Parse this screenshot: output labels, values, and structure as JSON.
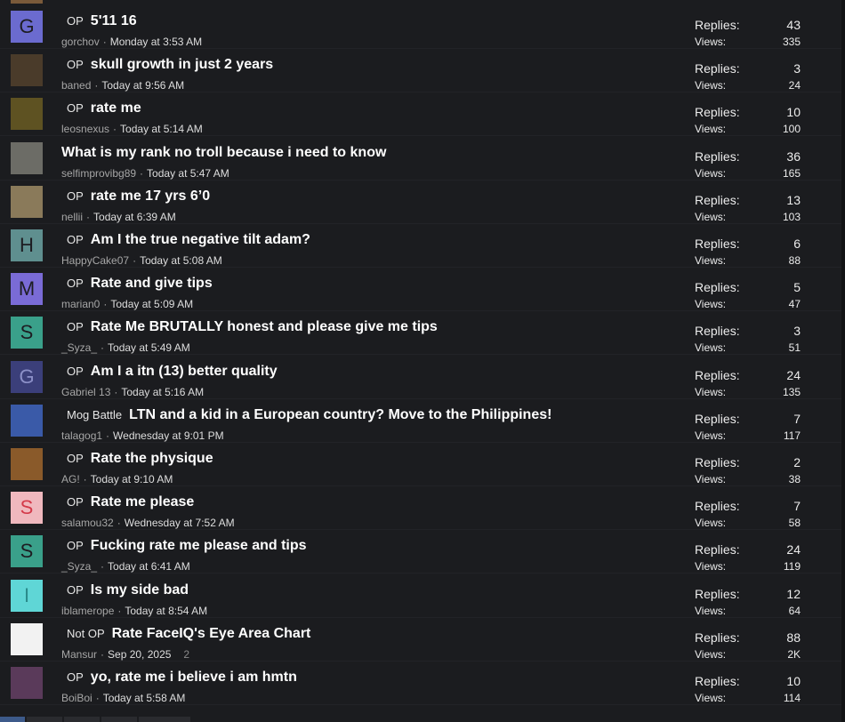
{
  "labels": {
    "replies": "Replies:",
    "views": "Views:"
  },
  "threads": [
    {
      "avatar": "G",
      "avatar_bg": "#6b6bcf",
      "prefix": "OP",
      "title": "5'11 16",
      "author": "gorchov",
      "date": "Monday at 3:53 AM",
      "pages": "",
      "replies": "43",
      "views": "335"
    },
    {
      "avatar": "",
      "avatar_bg": "#4a3b2a",
      "prefix": "OP",
      "title": "skull growth in just 2 years",
      "author": "baned",
      "date": "Today at 9:56 AM",
      "pages": "",
      "replies": "3",
      "views": "24"
    },
    {
      "avatar": "",
      "avatar_bg": "#5e5222",
      "prefix": "OP",
      "title": "rate me",
      "author": "leosnexus",
      "date": "Today at 5:14 AM",
      "pages": "",
      "replies": "10",
      "views": "100"
    },
    {
      "avatar": "",
      "avatar_bg": "#6c6c66",
      "prefix": "",
      "title": "What is my rank no troll because i need to know",
      "author": "selfimprovibg89",
      "date": "Today at 5:47 AM",
      "pages": "",
      "replies": "36",
      "views": "165"
    },
    {
      "avatar": "",
      "avatar_bg": "#8a7a5a",
      "prefix": "OP",
      "title": "rate me 17 yrs 6’0",
      "author": "nellii",
      "date": "Today at 6:39 AM",
      "pages": "",
      "replies": "13",
      "views": "103"
    },
    {
      "avatar": "H",
      "avatar_bg": "#5f8f8f",
      "prefix": "OP",
      "title": "Am I the true negative tilt adam?",
      "author": "HappyCake07",
      "date": "Today at 5:08 AM",
      "pages": "",
      "replies": "6",
      "views": "88"
    },
    {
      "avatar": "M",
      "avatar_bg": "#7a6bd6",
      "prefix": "OP",
      "title": "Rate and give tips",
      "author": "marian0",
      "date": "Today at 5:09 AM",
      "pages": "",
      "replies": "5",
      "views": "47"
    },
    {
      "avatar": "S",
      "avatar_bg": "#3aa08a",
      "prefix": "OP",
      "title": "Rate Me BRUTALLY honest and please give me tips",
      "author": "_Syza_",
      "date": "Today at 5:49 AM",
      "pages": "",
      "replies": "3",
      "views": "51"
    },
    {
      "avatar": "G",
      "avatar_bg": "#3b3f7a",
      "avatar_fg": "#8c90c8",
      "prefix": "OP",
      "title": "Am I a itn (13) better quality",
      "author": "Gabriel 13",
      "date": "Today at 5:16 AM",
      "pages": "",
      "replies": "24",
      "views": "135"
    },
    {
      "avatar": "",
      "avatar_bg": "#3a5aa8",
      "prefix": "Mog Battle",
      "title": "LTN and a kid in a European country? Move to the Philippines!",
      "author": "talagog1",
      "date": "Wednesday at 9:01 PM",
      "pages": "",
      "replies": "7",
      "views": "117"
    },
    {
      "avatar": "",
      "avatar_bg": "#8a5a2a",
      "prefix": "OP",
      "title": "Rate the physique",
      "author": "AG!",
      "date": "Today at 9:10 AM",
      "pages": "",
      "replies": "2",
      "views": "38"
    },
    {
      "avatar": "S",
      "avatar_bg": "#f0b8be",
      "avatar_fg": "#d43a4a",
      "prefix": "OP",
      "title": "Rate me please",
      "author": "salamou32",
      "date": "Wednesday at 7:52 AM",
      "pages": "",
      "replies": "7",
      "views": "58"
    },
    {
      "avatar": "S",
      "avatar_bg": "#3aa08a",
      "prefix": "OP",
      "title": "Fucking rate me please and tips",
      "author": "_Syza_",
      "date": "Today at 6:41 AM",
      "pages": "",
      "replies": "24",
      "views": "119"
    },
    {
      "avatar": "I",
      "avatar_bg": "#5fd6d6",
      "avatar_fg": "#2a8a8a",
      "prefix": "OP",
      "title": "Is my side bad",
      "author": "iblamerope",
      "date": "Today at 8:54 AM",
      "pages": "",
      "replies": "12",
      "views": "64"
    },
    {
      "avatar": "",
      "avatar_bg": "#f2f2f2",
      "prefix": "Not OP",
      "title": "Rate FaceIQ's Eye Area Chart",
      "author": "Mansur",
      "date": "Sep 20, 2025",
      "pages": "2",
      "replies": "88",
      "views": "2K"
    },
    {
      "avatar": "",
      "avatar_bg": "#5a3a5a",
      "prefix": "OP",
      "title": "yo, rate me i believe i am hmtn",
      "author": "BoiBoi",
      "date": "Today at 5:58 AM",
      "pages": "",
      "replies": "10",
      "views": "114"
    }
  ]
}
